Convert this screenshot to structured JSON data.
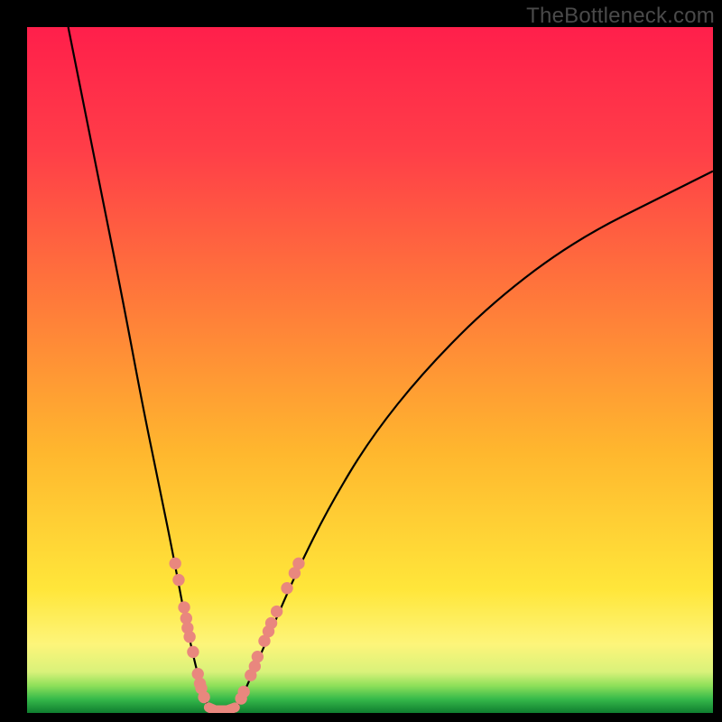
{
  "watermark": "TheBottleneck.com",
  "palette": {
    "gradient": {
      "c0": "#ff1f4b",
      "c1": "#ff3e48",
      "c2": "#ff7a3a",
      "c3": "#ffb72e",
      "c4": "#ffe63a",
      "c5": "#fdf57a",
      "c6": "#d9f27a",
      "c7": "#8fe05a",
      "c8": "#35b94a",
      "c9": "#0f7d2f"
    },
    "curve_color": "#000000",
    "dot_color": "#e9877e"
  },
  "chart_data": {
    "type": "line",
    "title": "",
    "xlabel": "",
    "ylabel": "",
    "xlim": [
      0,
      100
    ],
    "ylim": [
      0,
      100
    ],
    "series": [
      {
        "name": "left-curve",
        "x": [
          6,
          10,
          14,
          17,
          19.5,
          21.5,
          23,
          24.3,
          25.2,
          25.9,
          26.4,
          26.8
        ],
        "y": [
          100,
          80,
          60,
          44,
          32,
          22,
          14,
          8,
          4.5,
          2.2,
          0.9,
          0
        ]
      },
      {
        "name": "right-curve",
        "x": [
          30.2,
          30.9,
          32,
          33.6,
          36,
          39.5,
          44,
          50,
          58,
          68,
          80,
          94,
          100
        ],
        "y": [
          0,
          1.5,
          3.8,
          7.5,
          13,
          21,
          30,
          40,
          50,
          60,
          69,
          76,
          79
        ]
      }
    ],
    "markers_left": [
      {
        "x": 21.6,
        "y": 21.8
      },
      {
        "x": 22.1,
        "y": 19.4
      },
      {
        "x": 22.9,
        "y": 15.4
      },
      {
        "x": 23.2,
        "y": 13.8
      },
      {
        "x": 23.4,
        "y": 12.4
      },
      {
        "x": 23.7,
        "y": 11.1
      },
      {
        "x": 24.2,
        "y": 8.9
      },
      {
        "x": 24.9,
        "y": 5.7
      },
      {
        "x": 25.2,
        "y": 4.3
      },
      {
        "x": 25.4,
        "y": 3.6
      },
      {
        "x": 25.8,
        "y": 2.3
      }
    ],
    "markers_right": [
      {
        "x": 31.2,
        "y": 2.1
      },
      {
        "x": 31.6,
        "y": 3.1
      },
      {
        "x": 32.6,
        "y": 5.5
      },
      {
        "x": 33.2,
        "y": 6.8
      },
      {
        "x": 33.6,
        "y": 8.2
      },
      {
        "x": 34.6,
        "y": 10.5
      },
      {
        "x": 35.2,
        "y": 11.9
      },
      {
        "x": 35.6,
        "y": 13.1
      },
      {
        "x": 36.4,
        "y": 14.8
      },
      {
        "x": 37.9,
        "y": 18.2
      },
      {
        "x": 39.0,
        "y": 20.4
      },
      {
        "x": 39.6,
        "y": 21.8
      }
    ],
    "valley_connector": [
      {
        "x": 26.5,
        "y": 0.8
      },
      {
        "x": 27.4,
        "y": 0.4
      },
      {
        "x": 29.2,
        "y": 0.4
      },
      {
        "x": 30.3,
        "y": 0.8
      }
    ],
    "marker_radius_percent": 0.88
  }
}
